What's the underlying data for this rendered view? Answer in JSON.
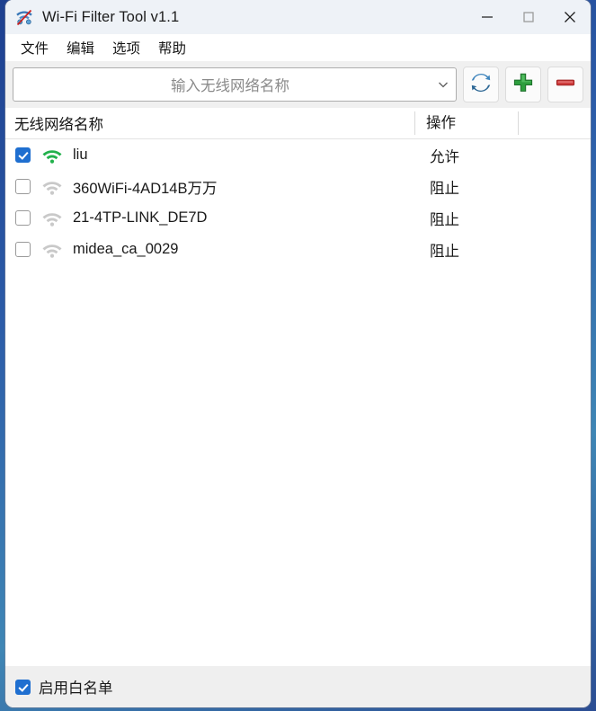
{
  "window": {
    "title": "Wi-Fi Filter Tool v1.1",
    "app_icon": "wifi-blocked-icon",
    "controls": {
      "minimize": "minimize-icon",
      "maximize": "maximize-icon",
      "close": "close-icon"
    }
  },
  "menubar": {
    "items": [
      {
        "label": "文件"
      },
      {
        "label": "编辑"
      },
      {
        "label": "选项"
      },
      {
        "label": "帮助"
      }
    ]
  },
  "toolbar": {
    "combo": {
      "value": "输入无线网络名称",
      "placeholder": "输入无线网络名称",
      "arrow_icon": "chevron-down-icon"
    },
    "buttons": [
      {
        "name": "refresh-button",
        "icon": "refresh-icon",
        "color": "#2f7ab5"
      },
      {
        "name": "add-button",
        "icon": "plus-icon",
        "color": "#2e9e3e"
      },
      {
        "name": "remove-button",
        "icon": "minus-icon",
        "color": "#cf3b3b"
      }
    ]
  },
  "list": {
    "headers": {
      "name": "无线网络名称",
      "action": "操作"
    },
    "rows": [
      {
        "checked": true,
        "signal_color": "#22b14c",
        "ssid": "liu",
        "action": "允许"
      },
      {
        "checked": false,
        "signal_color": "#c9c9c9",
        "ssid": "360WiFi-4AD14B万万",
        "action": "阻止"
      },
      {
        "checked": false,
        "signal_color": "#c9c9c9",
        "ssid": "21-4TP-LINK_DE7D",
        "action": "阻止"
      },
      {
        "checked": false,
        "signal_color": "#c9c9c9",
        "ssid": "midea_ca_0029",
        "action": "阻止"
      }
    ]
  },
  "footer": {
    "whitelist": {
      "label": "启用白名单",
      "checked": true
    }
  },
  "colors": {
    "accent_blue": "#1f6fd0",
    "signal_active": "#22b14c",
    "signal_inactive": "#c9c9c9",
    "desktop": "#2c5ca8"
  }
}
